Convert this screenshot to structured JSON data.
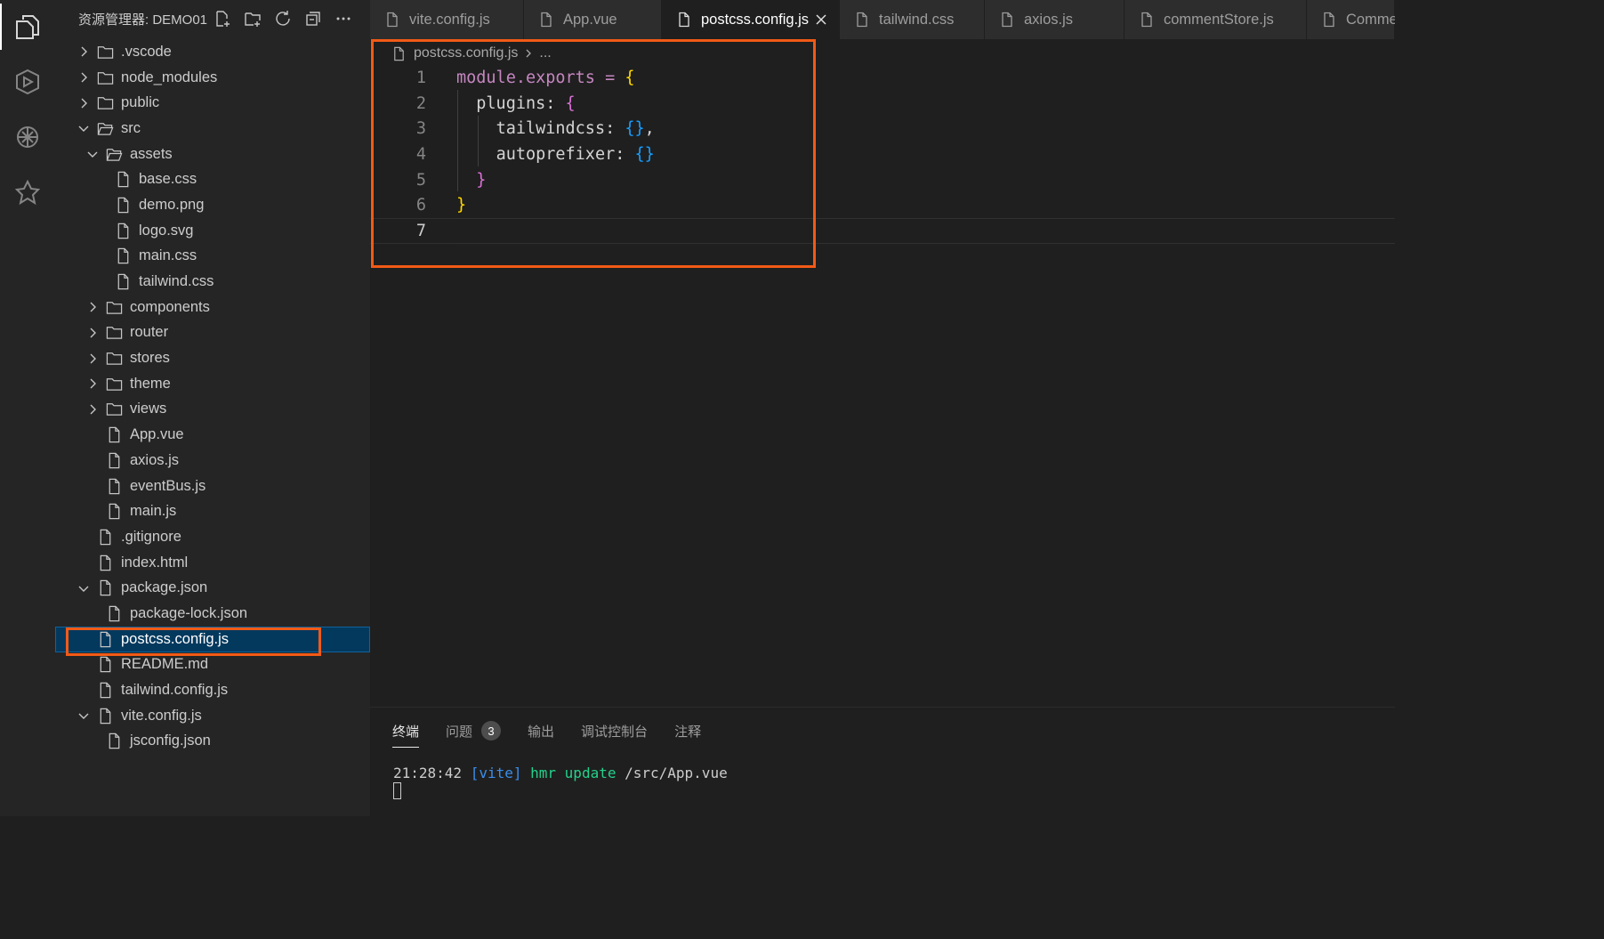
{
  "sidebar": {
    "title": "资源管理器: DEMO01",
    "tree": [
      {
        "label": ".vscode",
        "type": "folder",
        "expanded": false
      },
      {
        "label": "node_modules",
        "type": "folder",
        "expanded": false
      },
      {
        "label": "public",
        "type": "folder",
        "expanded": false
      },
      {
        "label": "src",
        "type": "folder",
        "expanded": true
      },
      {
        "label": "assets",
        "type": "folder",
        "expanded": true
      },
      {
        "label": "base.css",
        "type": "file"
      },
      {
        "label": "demo.png",
        "type": "file"
      },
      {
        "label": "logo.svg",
        "type": "file"
      },
      {
        "label": "main.css",
        "type": "file"
      },
      {
        "label": "tailwind.css",
        "type": "file"
      },
      {
        "label": "components",
        "type": "folder",
        "expanded": false
      },
      {
        "label": "router",
        "type": "folder",
        "expanded": false
      },
      {
        "label": "stores",
        "type": "folder",
        "expanded": false
      },
      {
        "label": "theme",
        "type": "folder",
        "expanded": false
      },
      {
        "label": "views",
        "type": "folder",
        "expanded": false
      },
      {
        "label": "App.vue",
        "type": "file"
      },
      {
        "label": "axios.js",
        "type": "file"
      },
      {
        "label": "eventBus.js",
        "type": "file"
      },
      {
        "label": "main.js",
        "type": "file"
      },
      {
        "label": ".gitignore",
        "type": "file"
      },
      {
        "label": "index.html",
        "type": "file"
      },
      {
        "label": "package.json",
        "type": "file",
        "expanded": true
      },
      {
        "label": "package-lock.json",
        "type": "file"
      },
      {
        "label": "postcss.config.js",
        "type": "file",
        "selected": true
      },
      {
        "label": "README.md",
        "type": "file"
      },
      {
        "label": "tailwind.config.js",
        "type": "file"
      },
      {
        "label": "vite.config.js",
        "type": "file",
        "expanded": true
      },
      {
        "label": "jsconfig.json",
        "type": "file"
      }
    ]
  },
  "tabs": [
    {
      "label": "vite.config.js"
    },
    {
      "label": "App.vue"
    },
    {
      "label": "postcss.config.js",
      "active": true
    },
    {
      "label": "tailwind.css"
    },
    {
      "label": "axios.js"
    },
    {
      "label": "commentStore.js"
    },
    {
      "label": "Comme"
    }
  ],
  "breadcrumb": {
    "file": "postcss.config.js",
    "rest": "..."
  },
  "code_lines": [
    "1",
    "2",
    "3",
    "4",
    "5",
    "6",
    "7"
  ],
  "code": {
    "l1": {
      "a": "module",
      "b": ".",
      "c": "exports",
      "d": " = ",
      "e": "{"
    },
    "l2": {
      "a": "plugins",
      "b": ": ",
      "c": "{"
    },
    "l3": {
      "a": "tailwindcss",
      "b": ": ",
      "c": "{}",
      "d": ","
    },
    "l4": {
      "a": "autoprefixer",
      "b": ": ",
      "c": "{}"
    },
    "l5": {
      "a": "}"
    },
    "l6": {
      "a": "}"
    }
  },
  "panel": {
    "tabs": [
      "终端",
      "问题",
      "输出",
      "调试控制台",
      "注释"
    ],
    "problems_count": "3",
    "terminal": {
      "time": "21:28:42",
      "tag": "[vite]",
      "msg": "hmr update",
      "path": "/src/App.vue"
    }
  },
  "colors": {
    "accent_highlight": "#f25a16",
    "selection": "#04395e"
  }
}
